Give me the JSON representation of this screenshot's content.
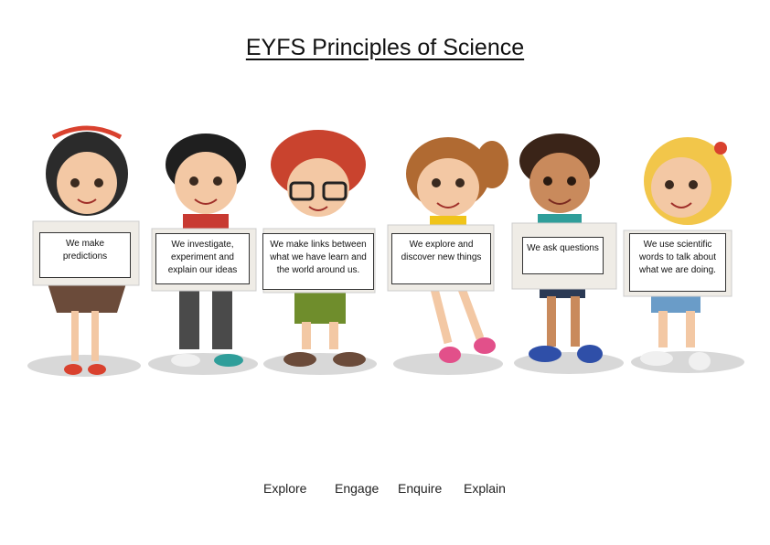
{
  "title": "EYFS Principles of Science",
  "principles": [
    "We make predictions",
    "We investigate, experiment and explain our ideas",
    "We make links between what we have learn and the world around us.",
    "We explore and discover new things",
    "We ask questions",
    "We use scientific words to talk about what we are doing."
  ],
  "footer": [
    "Explore",
    "Engage",
    "Enquire",
    "Explain"
  ]
}
